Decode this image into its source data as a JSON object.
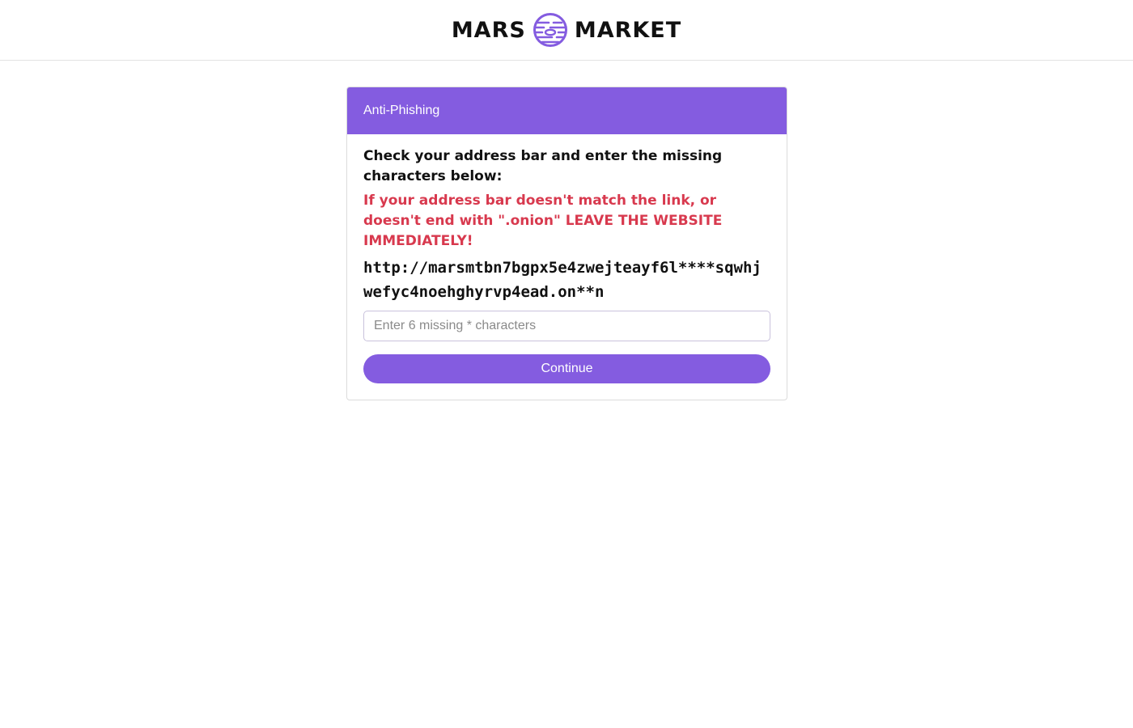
{
  "header": {
    "logo_left": "MARS",
    "logo_right": "MARKET",
    "logo_icon": "planet-icon",
    "accent_color": "#845ce0"
  },
  "card": {
    "title": "Anti-Phishing",
    "instruction": "Check your address bar and enter the missing characters below:",
    "warning": "If your address bar doesn't match the link, or doesn't end with \".onion\" LEAVE THE WEBSITE IMMEDIATELY!",
    "warning_color": "#d8394e",
    "url_masked": "http://marsmtbn7bgpx5e4zwejteayf6l****sqwhjwefyc4noehghyrvp4ead.on**n",
    "input": {
      "value": "",
      "placeholder": "Enter 6 missing * characters"
    },
    "continue_label": "Continue"
  }
}
